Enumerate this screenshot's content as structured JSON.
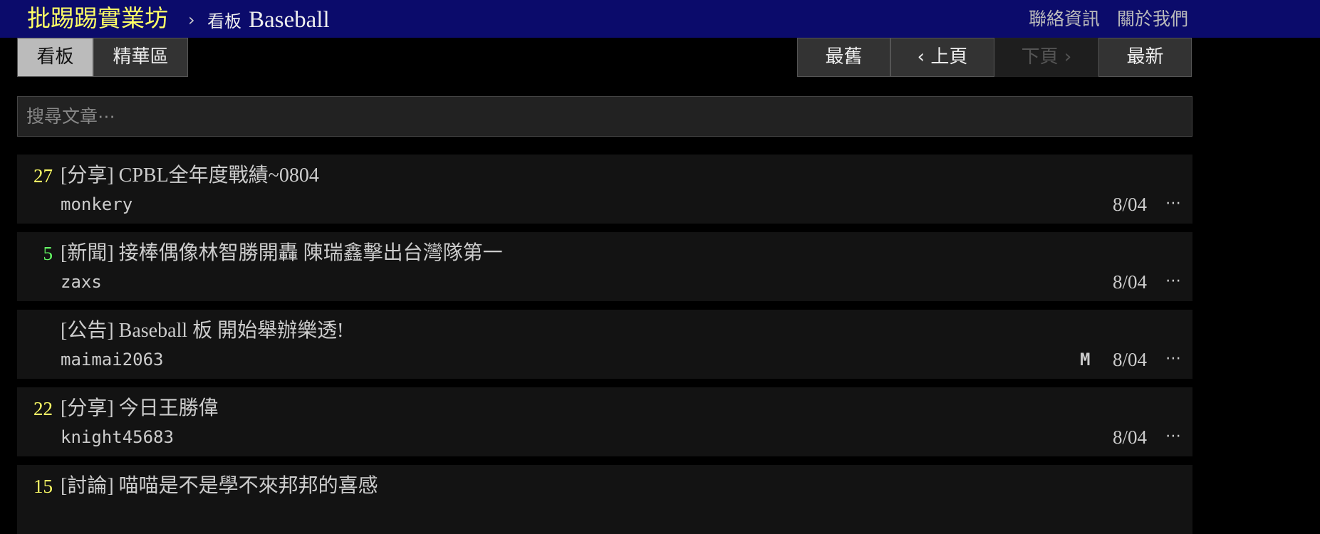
{
  "header": {
    "brand": "批踢踢實業坊",
    "separator": "›",
    "board_label": "看板",
    "board_name": "Baseball",
    "links": [
      "聯絡資訊",
      "關於我們"
    ]
  },
  "tabs": [
    {
      "label": "看板",
      "active": true
    },
    {
      "label": "精華區",
      "active": false
    }
  ],
  "pager": {
    "oldest": "最舊",
    "prev": "‹ 上頁",
    "next": "下頁 ›",
    "latest": "最新"
  },
  "search": {
    "placeholder": "搜尋文章⋯"
  },
  "posts": [
    {
      "nrec": "27",
      "nrec_color": "#ffff66",
      "title": "[分享] CPBL全年度戰績~0804",
      "author": "monkery",
      "mark": "",
      "date": "8/04",
      "more": "⋯"
    },
    {
      "nrec": "5",
      "nrec_color": "#66ff66",
      "title": "[新聞] 接棒偶像林智勝開轟 陳瑞鑫擊出台灣隊第一",
      "author": "zaxs",
      "mark": "",
      "date": "8/04",
      "more": "⋯"
    },
    {
      "nrec": "",
      "nrec_color": "#ccc",
      "title": "[公告] Baseball 板 開始舉辦樂透!",
      "author": "maimai2063",
      "mark": "M",
      "date": "8/04",
      "more": "⋯"
    },
    {
      "nrec": "22",
      "nrec_color": "#ffff66",
      "title": "[分享] 今日王勝偉",
      "author": "knight45683",
      "mark": "",
      "date": "8/04",
      "more": "⋯"
    },
    {
      "nrec": "15",
      "nrec_color": "#ffff66",
      "title": "[討論] 喵喵是不是學不來邦邦的喜感",
      "author": "",
      "mark": "",
      "date": "",
      "more": ""
    }
  ]
}
